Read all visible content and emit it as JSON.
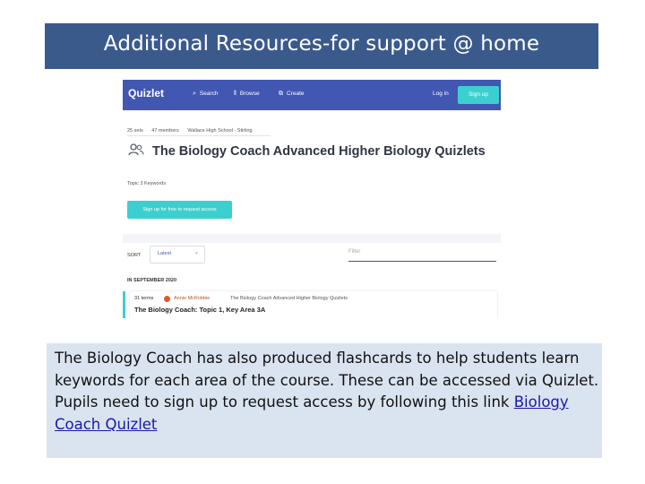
{
  "slide": {
    "title": "Additional Resources-for support @ home",
    "description": "The Biology Coach has also produced flashcards to help students learn keywords for each area of the course. These can be accessed via Quizlet. Pupils need to sign up to request access by following this link ",
    "link_text": "Biology Coach Quizlet"
  },
  "quizlet": {
    "logo": "Quizlet",
    "nav": {
      "search": "Search",
      "browse": "Browse",
      "create": "Create",
      "login": "Log in",
      "signup": "Sign up"
    },
    "meta": {
      "sets": "25 sets",
      "members": "47 members",
      "school": "Wallace High School - Stirling"
    },
    "class_title": "The Biology Coach Advanced Higher Biology Quizlets",
    "topic": "Topic 3 Keywords",
    "request_button": "Sign up for free to request access",
    "sort_label": "SORT",
    "sort_value": "Latest",
    "filter_placeholder": "Filter",
    "month": "IN SEPTEMBER 2020",
    "set_card": {
      "terms": "31 terms",
      "author": "Annie McRobbie",
      "class": "The Biology Coach Advanced Higher Biology Quizlets",
      "title": "The Biology Coach: Topic 1, Key Area 3A"
    }
  },
  "colors": {
    "title_bar": "#3b5a8c",
    "quizlet_nav": "#4257b2",
    "quizlet_accent": "#3ccfcf",
    "desc_box": "#dae3f0"
  }
}
